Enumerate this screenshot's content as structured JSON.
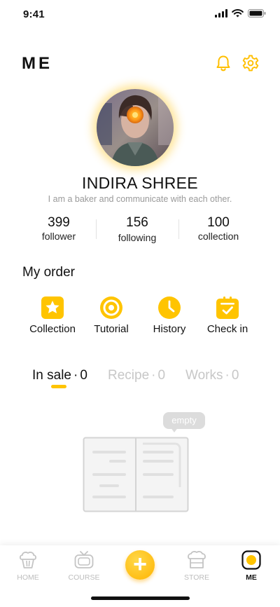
{
  "status_bar": {
    "time": "9:41",
    "icons": [
      "signal-icon",
      "wifi-icon",
      "battery-icon"
    ]
  },
  "header": {
    "title": "ME",
    "icons": [
      "bell-icon",
      "gear-icon"
    ]
  },
  "colors": {
    "accent": "#ffc400",
    "inactive": "#c7c7c7",
    "muted": "#9a9a9a"
  },
  "profile": {
    "name": "INDIRA SHREE",
    "bio": "I am a baker and communicate with each other.",
    "stats": [
      {
        "value": "399",
        "label": "follower"
      },
      {
        "value": "156",
        "label": "following"
      },
      {
        "value": "100",
        "label": "collection"
      }
    ]
  },
  "orders": {
    "title": "My order",
    "items": [
      {
        "label": "Collection",
        "icon": "star-icon"
      },
      {
        "label": "Tutorial",
        "icon": "target-icon"
      },
      {
        "label": "History",
        "icon": "clock-icon"
      },
      {
        "label": "Check in",
        "icon": "calendar-check-icon"
      }
    ]
  },
  "tabs": [
    {
      "label": "In sale",
      "count": "0",
      "active": true
    },
    {
      "label": "Recipe",
      "count": "0",
      "active": false
    },
    {
      "label": "Works",
      "count": "0",
      "active": false
    }
  ],
  "empty_state": {
    "bubble": "empty",
    "icon": "empty-book-icon"
  },
  "bottom_nav": {
    "items": [
      {
        "label": "HOME",
        "icon": "home-cupcake-icon",
        "active": false
      },
      {
        "label": "COURSE",
        "icon": "tv-icon",
        "active": false
      },
      {
        "label": "",
        "icon": "plus-icon",
        "active": false
      },
      {
        "label": "STORE",
        "icon": "store-icon",
        "active": false
      },
      {
        "label": "ME",
        "icon": "me-icon",
        "active": true
      }
    ]
  }
}
